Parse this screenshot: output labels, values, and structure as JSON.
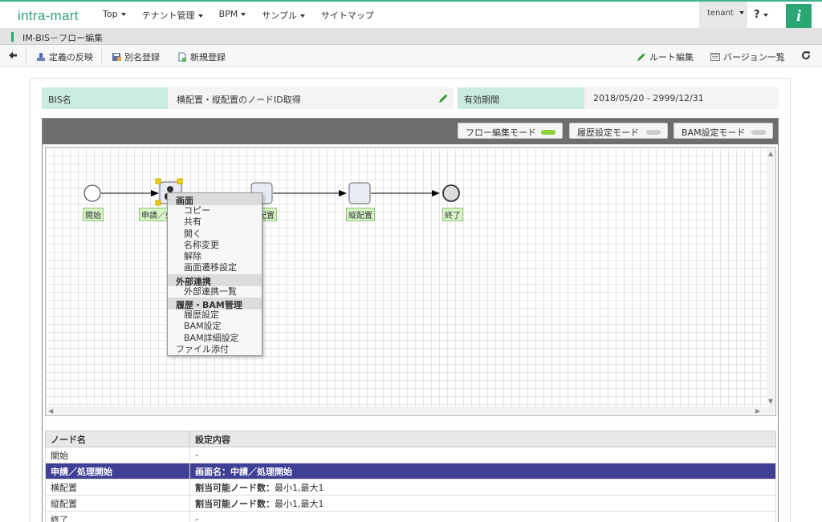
{
  "app": {
    "logo": "intra-mart",
    "nav": [
      "Top",
      "テナント管理",
      "BPM",
      "サンプル",
      "サイトマップ"
    ],
    "tenant": "tenant",
    "help": "?",
    "brand_icon_letter": "i"
  },
  "titlebar": {
    "title": "IM-BIS－フロー編集"
  },
  "toolbar": {
    "back": "back-arrow",
    "apply": "定義の反映",
    "save_as": "別名登録",
    "new": "新規登録",
    "route_edit": "ルート編集",
    "version_list": "バージョン一覧",
    "refresh": "refresh"
  },
  "info": {
    "bis_label": "BIS名",
    "bis_value": "横配置・縦配置のノードID取得",
    "period_label": "有効期間",
    "period_value": "2018/05/20 - 2999/12/31"
  },
  "modes": {
    "flow": "フロー編集モード",
    "history": "履歴設定モード",
    "bam": "BAM設定モード",
    "active_color": "#8bd23c",
    "inactive_color": "#cccccc"
  },
  "flow": {
    "nodes": [
      "開始",
      "申請／処理開始",
      "横配置",
      "縦配置",
      "終了"
    ],
    "node_label_start": "開始",
    "node_label_apply": "申請／処",
    "node_label_horizontal": "配置",
    "node_label_vertical": "縦配置",
    "node_label_end": "終了"
  },
  "context_menu": {
    "section1": "画面",
    "items1": [
      "コピー",
      "共有",
      "開く",
      "名称変更",
      "解除",
      "画面遷移設定"
    ],
    "section2": "外部連携",
    "items2": [
      "外部連携一覧"
    ],
    "section3": "履歴・BAM管理",
    "items3": [
      "履歴設定",
      "BAM設定",
      "BAM詳細設定"
    ],
    "last": "ファイル添付"
  },
  "table": {
    "col1": "ノード名",
    "col2": "設定内容",
    "rows": [
      {
        "name": "開始",
        "setting_bold": "",
        "setting": "-"
      },
      {
        "name": "申請／処理開始",
        "setting_bold": "画面名：中請／処理開始",
        "setting": ""
      },
      {
        "name": "横配置",
        "setting_bold": "割当可能ノード数：",
        "setting": "最小1,最大1"
      },
      {
        "name": "縦配置",
        "setting_bold": "割当可能ノード数：",
        "setting": "最小1,最大1"
      },
      {
        "name": "終了",
        "setting_bold": "",
        "setting": "-"
      }
    ]
  },
  "colors": {
    "accent": "#2aa775",
    "label_bg": "#c9ebe0",
    "selected_row": "#3f3f96"
  }
}
